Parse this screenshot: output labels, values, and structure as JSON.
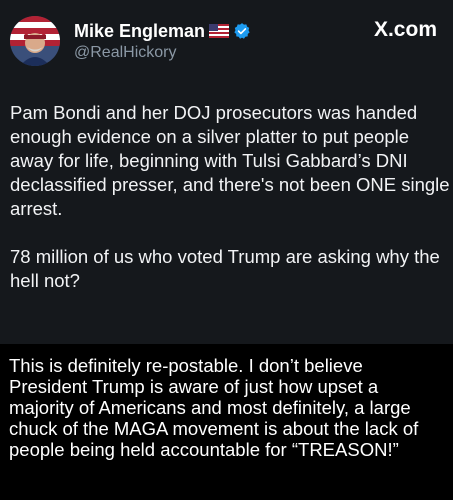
{
  "tweet": {
    "author_name": "Mike Engleman",
    "handle": "@RealHickory",
    "site": "X.com",
    "paragraphs": [
      "Pam Bondi and her DOJ prosecutors was handed enough evidence on a silver platter to put people away for life, beginning with Tulsi Gabbard’s DNI declassified presser, and there's not been ONE single arrest.",
      "78 million of us who voted Trump are asking why the hell not?"
    ]
  },
  "comment": {
    "text": "This is definitely re-postable. I don’t believe President Trump is aware of just how upset a majority of Americans and most definitely, a large chuck of the MAGA movement is about the lack of people being held accountable for “TREASON!”"
  },
  "icons": {
    "flag": "us-flag-icon",
    "verified": "verified-badge-icon",
    "logo": "x-logo"
  },
  "colors": {
    "card_background": "#15181c",
    "page_background": "#000000",
    "handle_gray": "#8b98a5",
    "verified_blue": "#1d9bf0"
  }
}
